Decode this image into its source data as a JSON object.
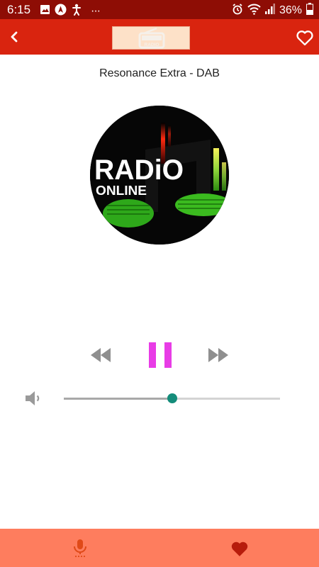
{
  "status_bar": {
    "time": "6:15",
    "battery_percent": "36%",
    "overflow": "···",
    "icons_left": [
      "image-icon",
      "nav-icon",
      "accessibility-icon"
    ],
    "icons_right": [
      "alarm-icon",
      "wifi-icon",
      "signal-icon",
      "battery-icon"
    ]
  },
  "toolbar": {
    "back_icon": "chevron-left-icon",
    "favorite_icon": "heart-outline-icon",
    "logo_text": "RADIO"
  },
  "station": {
    "title": "Resonance Extra - DAB",
    "artwork_text_main": "RADiO",
    "artwork_text_sub": "ONLINE"
  },
  "player": {
    "state": "playing",
    "volume": 0.5
  },
  "bottom_nav": {
    "items": [
      "mic-icon",
      "heart-icon"
    ]
  },
  "colors": {
    "status_bar": "#8e0d05",
    "toolbar": "#d9240f",
    "bottom_bar": "#fe7d5e",
    "pause_button": "#e83ce6",
    "control_gray": "#8f8f8f",
    "slider_thumb": "#148c7a",
    "mic_icon": "#e04a18",
    "heart_icon": "#b71c0c"
  }
}
